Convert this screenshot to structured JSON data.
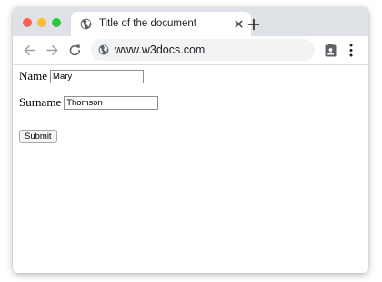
{
  "browser": {
    "tab": {
      "title": "Title of the document"
    },
    "address_bar": {
      "url": "www.w3docs.com"
    },
    "icons": [
      "globe-icon",
      "close-icon",
      "plus-icon",
      "back-arrow-icon",
      "forward-arrow-icon",
      "reload-icon",
      "extension-icon",
      "kebab-menu-icon"
    ],
    "colors": {
      "tabstrip": "#dee1e6",
      "omnibox": "#f1f3f4",
      "close_dot": "#fe5f57",
      "minimize_dot": "#febb2e",
      "zoom_dot": "#29c840"
    }
  },
  "form": {
    "name_label": "Name",
    "name_value": "Mary",
    "surname_label": "Surname",
    "surname_value": "Thomson",
    "submit_label": "Submit"
  }
}
